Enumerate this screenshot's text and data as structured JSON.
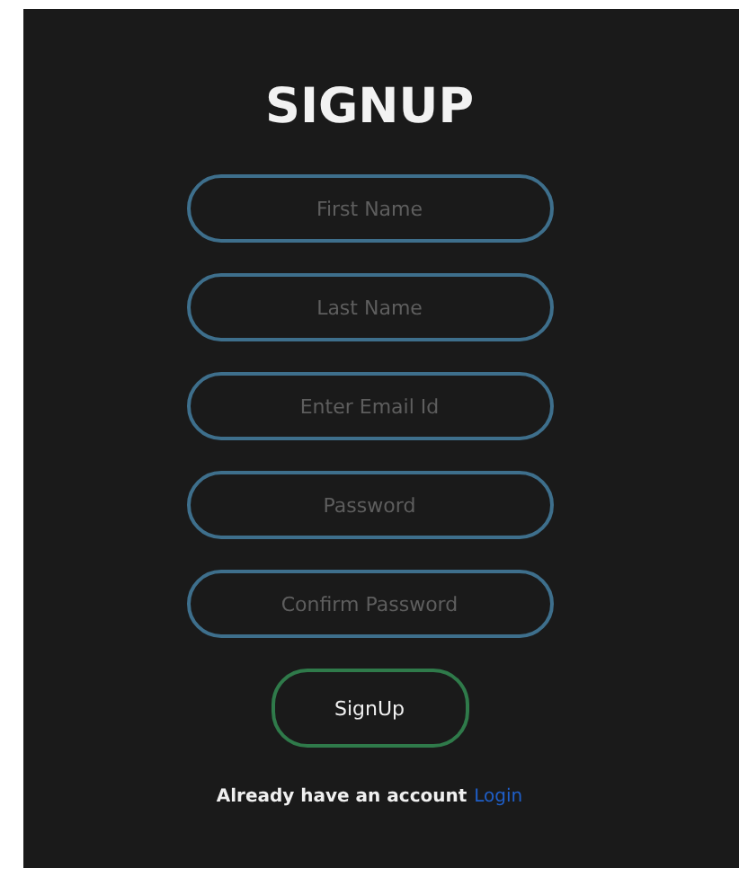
{
  "title": "SIGNUP",
  "fields": [
    {
      "placeholder": "First Name"
    },
    {
      "placeholder": "Last Name"
    },
    {
      "placeholder": "Enter Email Id"
    },
    {
      "placeholder": "Password"
    },
    {
      "placeholder": "Confirm Password"
    }
  ],
  "submit": "SignUp",
  "footer": {
    "text": "Already have an account",
    "link": "Login"
  }
}
